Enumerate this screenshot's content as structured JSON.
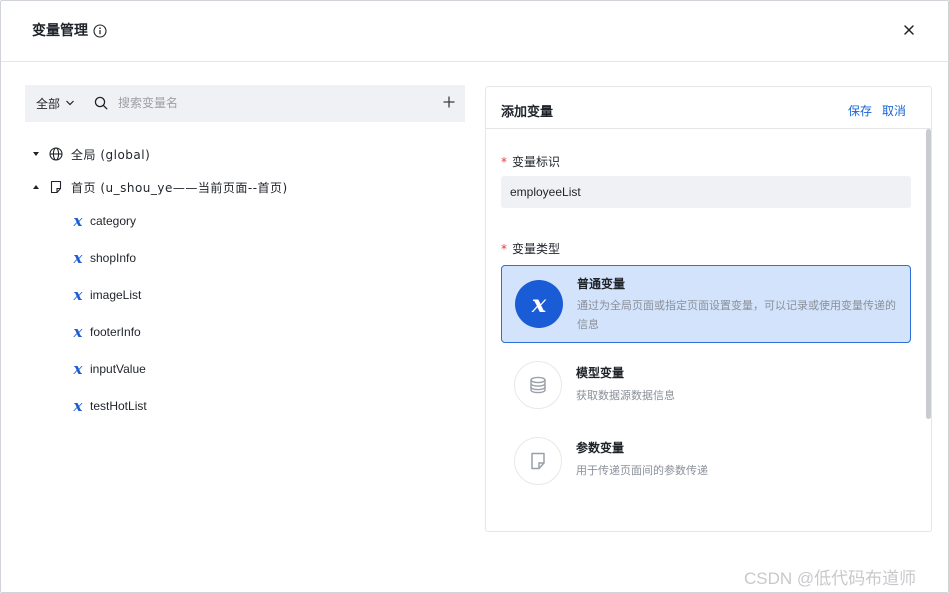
{
  "dialog": {
    "title": "变量管理",
    "info_icon": "info-circle-icon",
    "close_icon": "close-icon"
  },
  "toolbar": {
    "scope_label": "全部",
    "scope_icon": "chevron-down-icon",
    "search_icon": "search-icon",
    "search_placeholder": "搜索变量名",
    "search_value": "",
    "add_icon": "plus-icon"
  },
  "tree": {
    "global": {
      "label": "全局 (global)",
      "icon": "globe-icon",
      "expanded": false
    },
    "page": {
      "label": "首页 (u_shou_ye——当前页面--首页)",
      "icon": "page-icon",
      "expanded": true,
      "variables": [
        "category",
        "shopInfo",
        "imageList",
        "footerInfo",
        "inputValue",
        "testHotList"
      ]
    }
  },
  "panel": {
    "title": "添加变量",
    "save_label": "保存",
    "cancel_label": "取消",
    "id_field": {
      "required_mark": "*",
      "label": "变量标识",
      "value": "employeeList"
    },
    "type_field": {
      "required_mark": "*",
      "label": "变量类型"
    },
    "types": [
      {
        "name": "普通变量",
        "desc": "通过为全局页面或指定页面设置变量，可以记录或使用变量传递的信息",
        "icon": "variable-x-icon",
        "selected": true
      },
      {
        "name": "模型变量",
        "desc": "获取数据源数据信息",
        "icon": "database-icon",
        "selected": false
      },
      {
        "name": "参数变量",
        "desc": "用于传递页面间的参数传递",
        "icon": "document-icon",
        "selected": false
      }
    ]
  },
  "watermark": "CSDN @低代码布道师",
  "colors": {
    "accent": "#1a5bd6",
    "link": "#1a64d6",
    "selected_bg": "#d3e3fb",
    "required": "#e03a3a"
  }
}
